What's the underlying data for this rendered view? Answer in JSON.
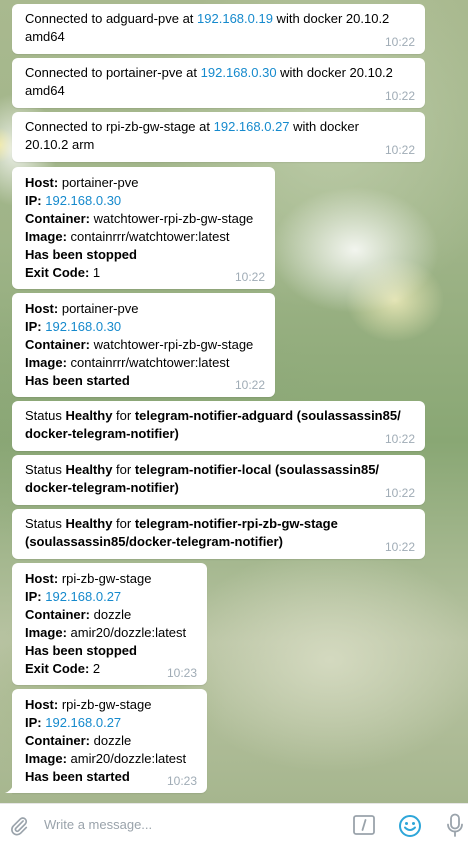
{
  "messages": [
    {
      "type": "connected",
      "prefix": "Connected to ",
      "name": "adguard-pve",
      "at": " at ",
      "ip": "192.168.0.19",
      "suffix_line1": " with docker 20.10.2",
      "suffix_line2": "amd64",
      "time": "10:22"
    },
    {
      "type": "connected",
      "prefix": "Connected to ",
      "name": "portainer-pve",
      "at": " at ",
      "ip": "192.168.0.30",
      "suffix_line1": " with docker 20.10.2",
      "suffix_line2": "amd64",
      "time": "10:22"
    },
    {
      "type": "connected",
      "prefix": "Connected to ",
      "name": "rpi-zb-gw-stage",
      "at": " at ",
      "ip": "192.168.0.27",
      "suffix_line1": " with docker",
      "suffix_line2": "20.10.2 arm",
      "time": "10:22"
    },
    {
      "type": "container",
      "host_label": "Host:",
      "host": "portainer-pve",
      "ip_label": "IP:",
      "ip": "192.168.0.30",
      "container_label": "Container:",
      "container": "watchtower-rpi-zb-gw-stage",
      "image_label": "Image:",
      "image": "containrrr/watchtower:latest",
      "status": "Has been stopped",
      "exit_label": "Exit Code:",
      "exit": "1",
      "time": "10:22"
    },
    {
      "type": "container",
      "host_label": "Host:",
      "host": "portainer-pve",
      "ip_label": "IP:",
      "ip": "192.168.0.30",
      "container_label": "Container:",
      "container": "watchtower-rpi-zb-gw-stage",
      "image_label": "Image:",
      "image": "containrrr/watchtower:latest",
      "status": "Has been started",
      "time": "10:22"
    },
    {
      "type": "status",
      "prefix": "Status ",
      "state": "Healthy",
      "for": " for ",
      "name_line1": "telegram-notifier-adguard (soulassassin85/",
      "name_line2": "docker-telegram-notifier)",
      "time": "10:22"
    },
    {
      "type": "status",
      "prefix": "Status ",
      "state": "Healthy",
      "for": " for ",
      "name_line1": "telegram-notifier-local (soulassassin85/",
      "name_line2": "docker-telegram-notifier)",
      "time": "10:22"
    },
    {
      "type": "status",
      "prefix": "Status ",
      "state": "Healthy",
      "for": " for ",
      "name_line1": "telegram-notifier-rpi-zb-gw-stage",
      "name_line2": "(soulassassin85/docker-telegram-notifier)",
      "time": "10:22"
    },
    {
      "type": "container",
      "host_label": "Host:",
      "host": "rpi-zb-gw-stage",
      "ip_label": "IP:",
      "ip": "192.168.0.27",
      "container_label": "Container:",
      "container": "dozzle",
      "image_label": "Image:",
      "image": "amir20/dozzle:latest",
      "status": "Has been stopped",
      "exit_label": "Exit Code:",
      "exit": "2",
      "time": "10:23"
    },
    {
      "type": "container",
      "host_label": "Host:",
      "host": "rpi-zb-gw-stage",
      "ip_label": "IP:",
      "ip": "192.168.0.27",
      "container_label": "Container:",
      "container": "dozzle",
      "image_label": "Image:",
      "image": "amir20/dozzle:latest",
      "status": "Has been started",
      "time": "10:23"
    }
  ],
  "composer": {
    "placeholder": "Write a message...",
    "attach_icon": "paperclip-icon",
    "command_icon": "slash-command-icon",
    "emoji_icon": "emoji-icon",
    "mic_icon": "microphone-icon"
  },
  "colors": {
    "link": "#168acd",
    "time": "#a0acb6",
    "icon": "#9aa3ab",
    "emoji": "#2ea6d9"
  }
}
